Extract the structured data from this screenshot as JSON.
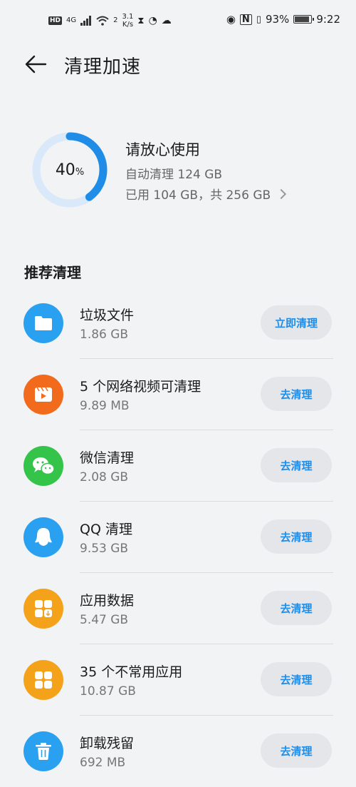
{
  "status_bar": {
    "hd": "HD",
    "network": "4G",
    "wifi_badge": "2",
    "speed_value": "3.1",
    "speed_unit": "K/s",
    "battery": "93%",
    "battery_level": 0.93,
    "time": "9:22"
  },
  "header": {
    "title": "清理加速"
  },
  "storage": {
    "percent": "40",
    "percent_sign": "%",
    "percent_value": 40,
    "title": "请放心使用",
    "auto_clean": "自动清理 124 GB",
    "usage": "已用 104 GB，共 256 GB",
    "ring_color": "#1f8de8",
    "track_color": "#d9e9f9"
  },
  "section": {
    "title": "推荐清理"
  },
  "items": [
    {
      "name": "垃圾文件",
      "size": "1.86 GB",
      "action": "立即清理",
      "icon": "folder-icon",
      "color": "#2aa1f0"
    },
    {
      "name": "5 个网络视频可清理",
      "size": "9.89 MB",
      "action": "去清理",
      "icon": "video-icon",
      "color": "#f26a1b"
    },
    {
      "name": "微信清理",
      "size": "2.08 GB",
      "action": "去清理",
      "icon": "wechat-icon",
      "color": "#35c44a"
    },
    {
      "name": "QQ 清理",
      "size": "9.53 GB",
      "action": "去清理",
      "icon": "qq-icon",
      "color": "#2aa1f0"
    },
    {
      "name": "应用数据",
      "size": "5.47 GB",
      "action": "去清理",
      "icon": "app-data-icon",
      "color": "#f4a21a"
    },
    {
      "name": "35 个不常用应用",
      "size": "10.87 GB",
      "action": "去清理",
      "icon": "apps-icon",
      "color": "#f4a21a"
    },
    {
      "name": "卸载残留",
      "size": "692 MB",
      "action": "去清理",
      "icon": "trash-icon",
      "color": "#2aa1f0"
    }
  ]
}
